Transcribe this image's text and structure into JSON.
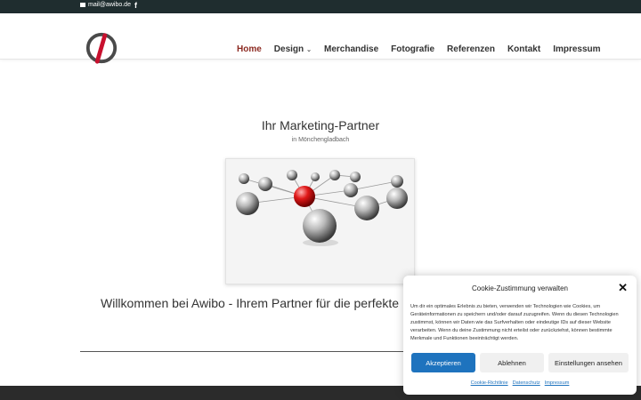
{
  "topbar": {
    "email": "mail@awibo.de",
    "facebook_icon": "facebook-icon"
  },
  "nav": {
    "items": [
      {
        "label": "Home",
        "active": true
      },
      {
        "label": "Design",
        "dropdown": true
      },
      {
        "label": "Merchandise"
      },
      {
        "label": "Fotografie"
      },
      {
        "label": "Referenzen"
      },
      {
        "label": "Kontakt"
      },
      {
        "label": "Impressum"
      }
    ],
    "active_color": "#8c2a21"
  },
  "hero": {
    "title": "Ihr Marketing-Partner",
    "subtitle": "in Mönchengladbach"
  },
  "welcome": "Willkommen bei Awibo - Ihrem Partner für die perfekte Umsetzung",
  "cookie": {
    "title": "Cookie-Zustimmung verwalten",
    "text": "Um dir ein optimales Erlebnis zu bieten, verwenden wir Technologien wie Cookies, um Geräteinformationen zu speichern und/oder darauf zuzugreifen. Wenn du diesen Technologien zustimmst, können wir Daten wie das Surfverhalten oder eindeutige IDs auf dieser Website verarbeiten. Wenn du deine Zustimmung nicht erteilst oder zurückziehst, können bestimmte Merkmale und Funktionen beeinträchtigt werden.",
    "accept": "Akzeptieren",
    "deny": "Ablehnen",
    "settings": "Einstellungen ansehen",
    "links": [
      "Cookie-Richtlinie",
      "Datenschutz",
      "Impressum"
    ],
    "accent": "#1e73be"
  },
  "colors": {
    "topbar": "#1f2d2f",
    "footer": "#2b2b2b"
  }
}
